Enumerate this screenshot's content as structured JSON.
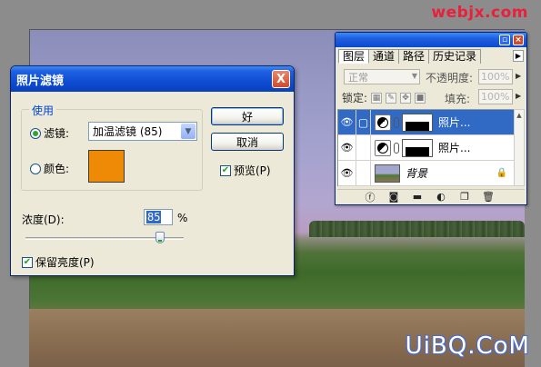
{
  "watermarks": {
    "top": "webjx.com",
    "bottom": "UiBQ.CoM"
  },
  "dialog": {
    "title": "照片滤镜",
    "close_label": "X",
    "use_group_label": "使用",
    "filter_radio_label": "滤镜:",
    "filter_value": "加温滤镜 (85)",
    "color_radio_label": "颜色:",
    "swatch_color": "#ee8a05",
    "ok_label": "好",
    "cancel_label": "取消",
    "preview_label": "预览(P)",
    "preview_checked": true,
    "density_label": "浓度(D):",
    "density_value": "85",
    "density_unit": "%",
    "density_level": 0.85,
    "preserve_label": "保留亮度(P)",
    "preserve_checked": true
  },
  "layers_palette": {
    "tabs": [
      "图层",
      "通道",
      "路径",
      "历史记录"
    ],
    "blend_mode": "正常",
    "opacity_label": "不透明度:",
    "opacity_value": "100%",
    "lock_label": "锁定:",
    "fill_label": "填充:",
    "fill_value": "100%",
    "layers": [
      {
        "name": "照片...",
        "selected": true
      },
      {
        "name": "照片...",
        "selected": false
      },
      {
        "name": "背景",
        "selected": false
      }
    ]
  }
}
